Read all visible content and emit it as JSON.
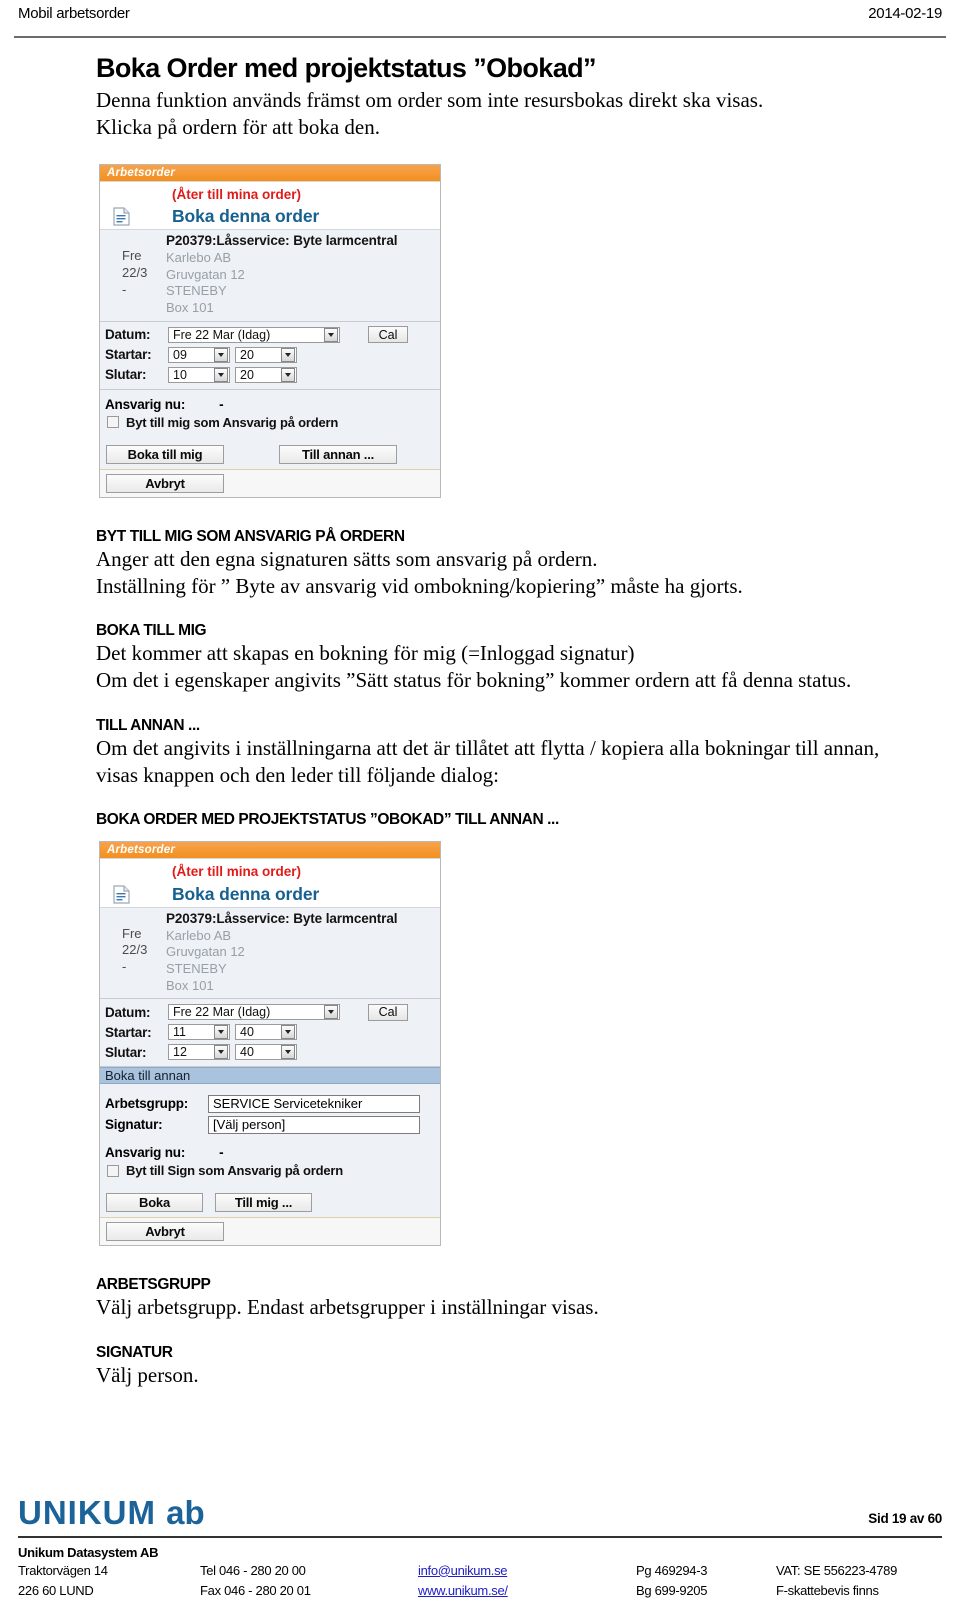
{
  "page_header": {
    "left": "Mobil arbetsorder",
    "date": "2014-02-19"
  },
  "document": {
    "title": "Boka Order med projektstatus ”Obokad”",
    "lead_line1": "Denna funktion används främst om order som inte resursbokas direkt ska visas.",
    "lead_line2": "Klicka på ordern för att boka den."
  },
  "screenshot1": {
    "titlebar": "Arbetsorder",
    "back_link": "(Åter till mina order)",
    "heading": "Boka denna order",
    "doc_icon": "document-icon",
    "order": {
      "day": "Fre",
      "date": "22/3",
      "dash": "-",
      "title": "P20379:Låsservice: Byte larmcentral",
      "customer": "Karlebo AB",
      "street": "Gruvgatan 12",
      "city": "STENEBY",
      "box": "Box 101"
    },
    "fields": {
      "datum_label": "Datum:",
      "datum_value": "Fre 22 Mar (Idag)",
      "cal_button": "Cal",
      "startar_label": "Startar:",
      "startar_hour": "09",
      "startar_min": "20",
      "slutar_label": "Slutar:",
      "slutar_hour": "10",
      "slutar_min": "20"
    },
    "responsible": {
      "label": "Ansvarig nu:",
      "value": "-",
      "checkbox_label": "Byt till mig som Ansvarig på ordern"
    },
    "buttons": {
      "primary": "Boka till mig",
      "secondary": "Till annan ...",
      "cancel": "Avbryt"
    }
  },
  "sections": [
    {
      "head": "BYT TILL MIG SOM ANSVARIG PÅ ORDERN",
      "line1": "Anger att den egna signaturen sätts som ansvarig på ordern.",
      "line2": "Inställning för ” Byte av ansvarig vid ombokning/kopiering” måste ha gjorts."
    },
    {
      "head": "BOKA TILL MIG",
      "line1": "Det kommer att skapas en bokning för mig (=Inloggad signatur)",
      "line2": "Om det i egenskaper angivits ”Sätt status för bokning” kommer ordern att få denna status."
    },
    {
      "head": "TILL ANNAN ...",
      "line1": "Om det angivits i inställningarna att det är tillåtet att flytta / kopiera alla bokningar till annan,",
      "line2": "visas knappen och den leder till följande dialog:"
    }
  ],
  "screenshot2_caption": "BOKA ORDER MED PROJEKTSTATUS ”OBOKAD” TILL ANNAN ...",
  "screenshot2": {
    "titlebar": "Arbetsorder",
    "back_link": "(Åter till mina order)",
    "heading": "Boka denna order",
    "doc_icon": "document-icon",
    "order": {
      "day": "Fre",
      "date": "22/3",
      "dash": "-",
      "title": "P20379:Låsservice: Byte larmcentral",
      "customer": "Karlebo AB",
      "street": "Gruvgatan 12",
      "city": "STENEBY",
      "box": "Box 101"
    },
    "fields": {
      "datum_label": "Datum:",
      "datum_value": "Fre 22 Mar (Idag)",
      "cal_button": "Cal",
      "startar_label": "Startar:",
      "startar_hour": "11",
      "startar_min": "40",
      "slutar_label": "Slutar:",
      "slutar_hour": "12",
      "slutar_min": "40"
    },
    "band": "Boka till annan",
    "selects": {
      "arbetsgrupp_label": "Arbetsgrupp:",
      "arbetsgrupp_value": "SERVICE Servicetekniker",
      "signatur_label": "Signatur:",
      "signatur_value": "[Välj person]"
    },
    "responsible": {
      "label": "Ansvarig nu:",
      "value": "-",
      "checkbox_label": "Byt till Sign som Ansvarig på ordern"
    },
    "buttons": {
      "primary": "Boka",
      "secondary": "Till mig ...",
      "cancel": "Avbryt"
    }
  },
  "sections_bottom": [
    {
      "head": "ARBETSGRUPP",
      "line1": "Välj arbetsgrupp. Endast arbetsgrupper i inställningar visas."
    },
    {
      "head": "SIGNATUR",
      "line1": "Välj person."
    }
  ],
  "footer": {
    "brand_main": "UNIKUM",
    "brand_sub": "ab",
    "page": "Sid 19 av 60",
    "company": "Unikum Datasystem AB",
    "address1": "Traktorvägen 14",
    "address2": "226 60  LUND",
    "tel": "Tel  046 - 280 20 00",
    "fax": "Fax  046 - 280 20 01",
    "email": "info@unikum.se",
    "web": "www.unikum.se/",
    "pg": "Pg  469294-3",
    "bg": "Bg  699-9205",
    "vat": "VAT: SE 556223-4789",
    "tax": "F-skattebevis finns"
  },
  "colors": {
    "accent_orange": "#f2901f",
    "heading_blue": "#17608f",
    "link_red": "#e01b18",
    "band_blue": "#a9c2dd",
    "brand_blue": "#1b6399",
    "footer_link": "#2020c8"
  }
}
